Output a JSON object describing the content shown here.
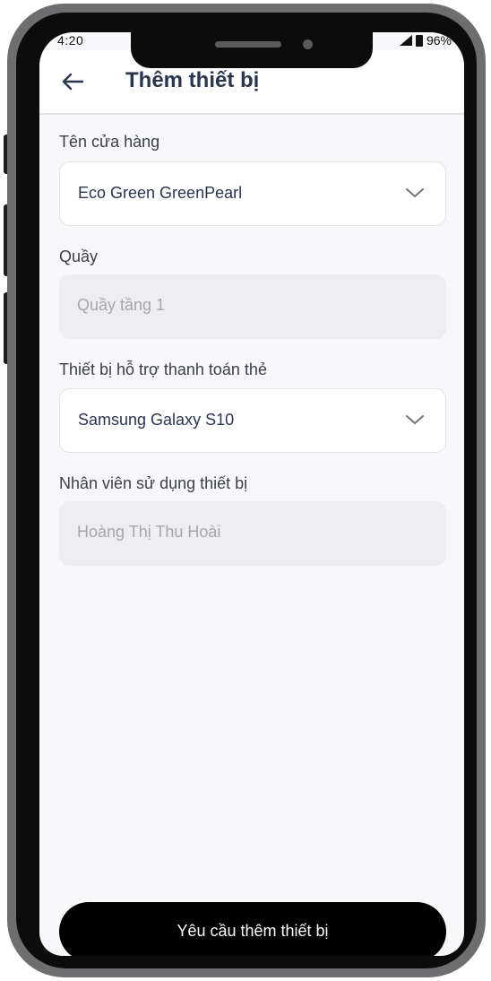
{
  "status_bar": {
    "time": "4:20",
    "battery": "96%"
  },
  "header": {
    "title": "Thêm thiết bị",
    "back_icon": "arrow-left-icon"
  },
  "form": {
    "store": {
      "label": "Tên cửa hàng",
      "value": "Eco Green GreenPearl",
      "icon": "chevron-down-icon"
    },
    "counter": {
      "label": "Quầy",
      "value": "Quầy tầng 1"
    },
    "device": {
      "label": "Thiết bị hỗ trợ thanh toán thẻ",
      "value": "Samsung Galaxy S10",
      "icon": "chevron-down-icon"
    },
    "employee": {
      "label": "Nhân viên sử dụng thiết bị",
      "value": "Hoàng Thị Thu Hoài"
    }
  },
  "submit": {
    "label": "Yêu cầu thêm thiết bị"
  },
  "colors": {
    "title": "#2a3650",
    "button": "#000000",
    "background": "#f8f8fa",
    "readonly_field": "#eeeef1"
  }
}
